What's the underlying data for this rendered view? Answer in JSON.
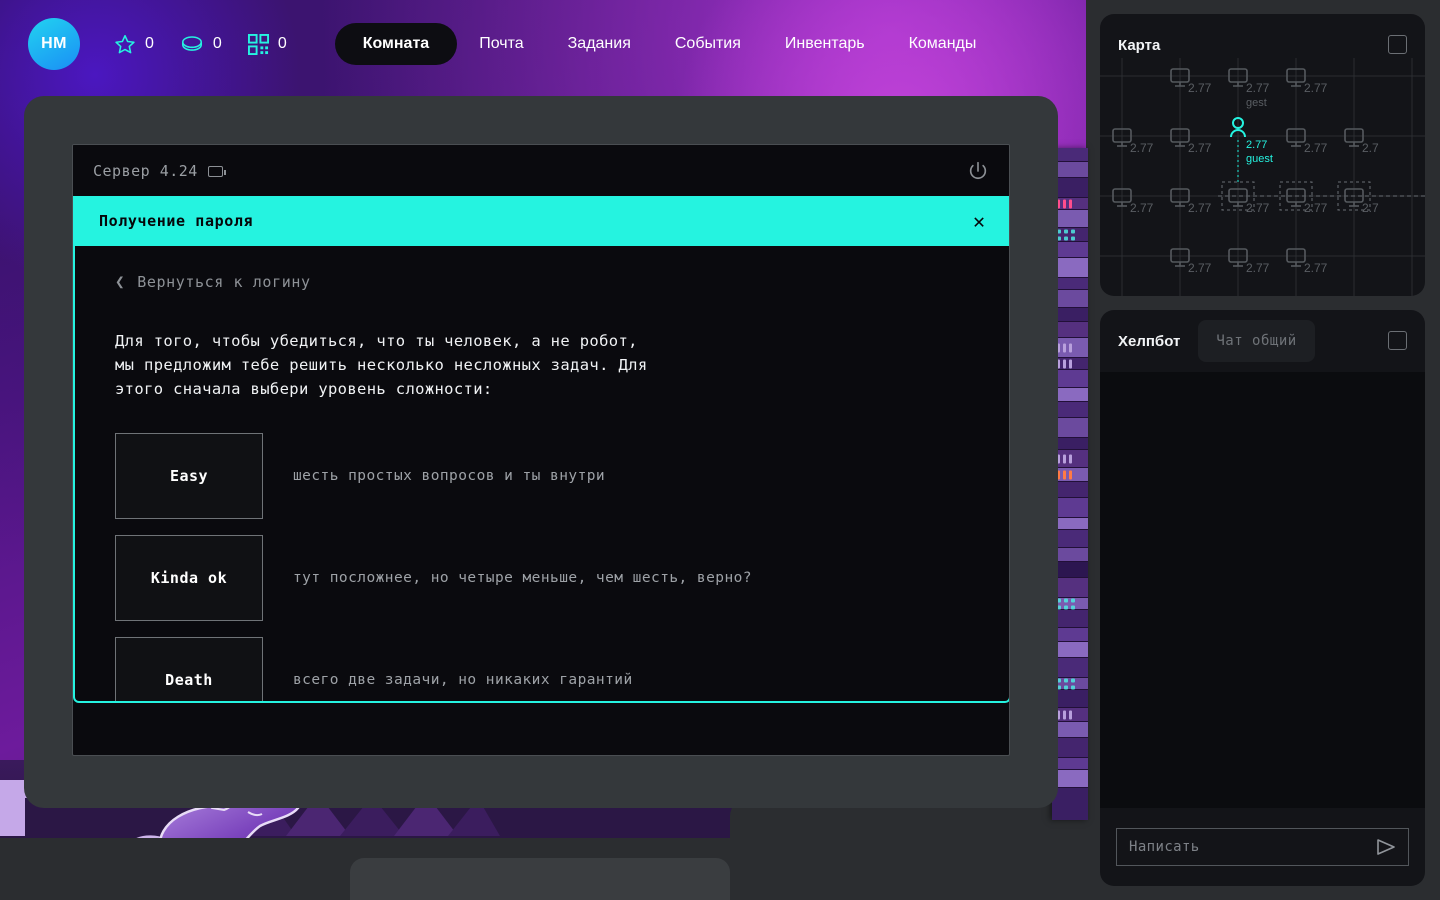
{
  "topnav": {
    "avatar_initials": "HM",
    "stats": [
      {
        "icon": "star-icon",
        "value": "0"
      },
      {
        "icon": "coin-icon",
        "value": "0"
      },
      {
        "icon": "qr-icon",
        "value": "0"
      }
    ],
    "links": [
      {
        "label": "Комната",
        "active": true
      },
      {
        "label": "Почта",
        "active": false
      },
      {
        "label": "Задания",
        "active": false
      },
      {
        "label": "События",
        "active": false
      },
      {
        "label": "Инвентарь",
        "active": false
      },
      {
        "label": "Команды",
        "active": false
      }
    ],
    "accent_avatar_from": "#22d3f0",
    "accent_avatar_to": "#1a8ef5",
    "icon_color": "#25f3e0"
  },
  "terminal": {
    "title": "Сервер 4.24",
    "battery_icon": "battery-icon",
    "power_icon": "power-icon"
  },
  "modal": {
    "title": "Получение пароля",
    "close_icon": "close-icon",
    "back_link": "Вернуться к логину",
    "back_icon": "chevron-left-icon",
    "intro": "Для того, чтобы убедиться, что ты человек, а не робот,\nмы предложим тебе решить несколько несложных задач. Для\nэтого сначала выбери уровень сложности:",
    "accent": "#25f3e0",
    "choices": [
      {
        "label": "Easy",
        "desc": "шесть простых вопросов и ты внутри"
      },
      {
        "label": "Kinda ok",
        "desc": "тут посложнее, но четыре меньше, чем шесть, верно?"
      },
      {
        "label": "Death",
        "desc": "всего две задачи, но никаких гарантий"
      }
    ]
  },
  "map_panel": {
    "title": "Карта",
    "expand_icon": "expand-icon",
    "player_label": "guest",
    "player_value": "2.77",
    "guest_label": "gest",
    "node_label": "2.77",
    "player_color": "#25f3e0",
    "nodes": [
      {
        "col": 1,
        "row": 0,
        "label": "2.77",
        "sub": ""
      },
      {
        "col": 2,
        "row": 0,
        "label": "2.77",
        "sub": "gest"
      },
      {
        "col": 3,
        "row": 0,
        "label": "2.77",
        "sub": ""
      },
      {
        "col": 0,
        "row": 1,
        "label": "2.77",
        "sub": ""
      },
      {
        "col": 1,
        "row": 1,
        "label": "2.77",
        "sub": ""
      },
      {
        "col": 2,
        "row": 1,
        "label": "2.77",
        "sub": "guest"
      },
      {
        "col": 3,
        "row": 1,
        "label": "2.77",
        "sub": ""
      },
      {
        "col": 4,
        "row": 1,
        "label": "2.7",
        "sub": ""
      },
      {
        "col": 0,
        "row": 2,
        "label": "2.77",
        "sub": ""
      },
      {
        "col": 1,
        "row": 2,
        "label": "2.77",
        "sub": ""
      },
      {
        "col": 2,
        "row": 2,
        "label": "2.77",
        "sub": ""
      },
      {
        "col": 3,
        "row": 2,
        "label": "2.77",
        "sub": ""
      },
      {
        "col": 4,
        "row": 2,
        "label": "2.7",
        "sub": ""
      },
      {
        "col": 1,
        "row": 3,
        "label": "2.77",
        "sub": ""
      },
      {
        "col": 2,
        "row": 3,
        "label": "2.77",
        "sub": ""
      },
      {
        "col": 3,
        "row": 3,
        "label": "2.77",
        "sub": ""
      }
    ]
  },
  "chat_panel": {
    "tab_active": "Хелпбот",
    "tab_inactive": "Чат общий",
    "expand_icon": "expand-icon",
    "input_placeholder": "Написать",
    "input_value": "",
    "send_icon": "send-icon"
  }
}
